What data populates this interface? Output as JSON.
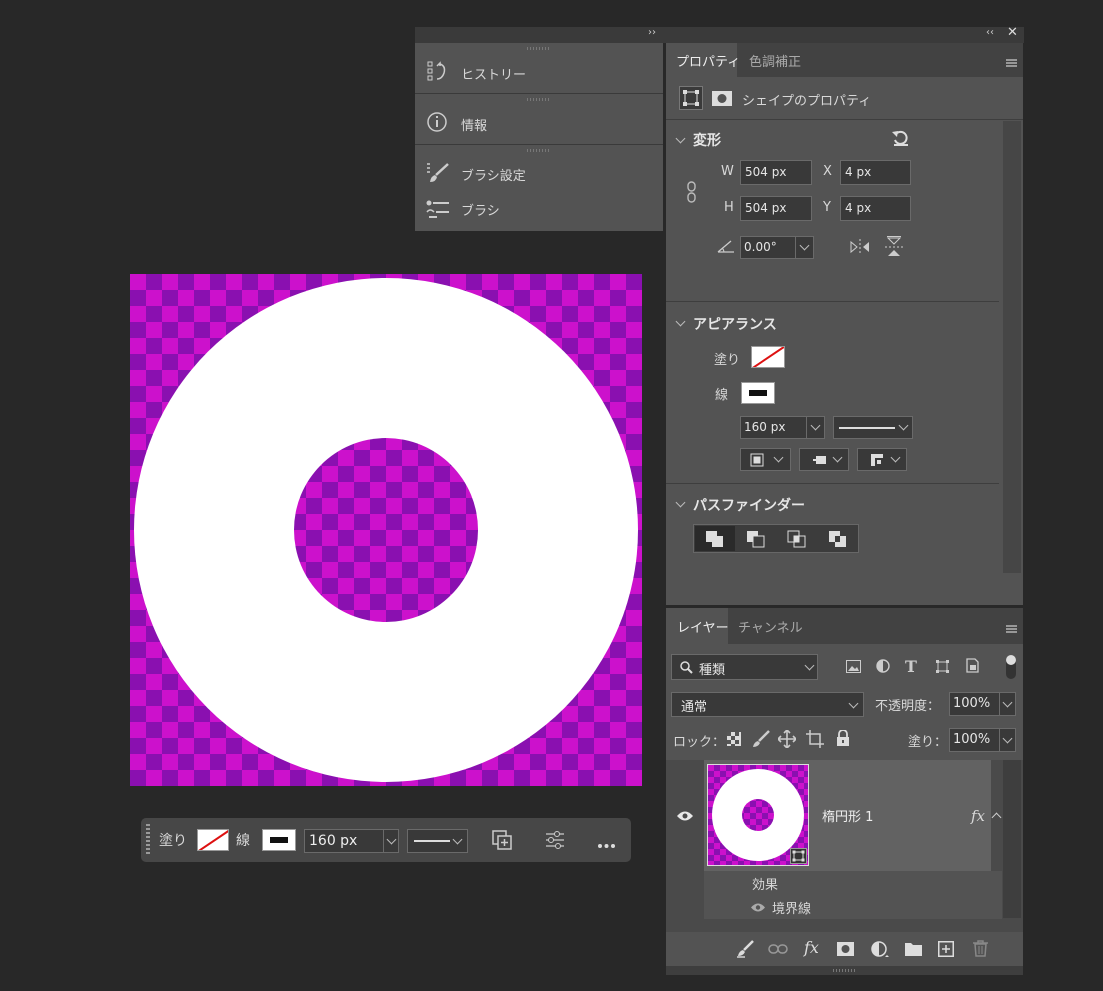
{
  "top_panel": {
    "items": [
      {
        "label": "ヒストリー",
        "icon": "history-icon"
      },
      {
        "label": "情報",
        "icon": "info-icon"
      },
      {
        "label": "ブラシ設定",
        "icon": "brush-settings-icon"
      },
      {
        "label": "ブラシ",
        "icon": "brushes-icon"
      }
    ]
  },
  "properties": {
    "tabs": [
      "プロパティ",
      "色調補正"
    ],
    "shape_title": "シェイプのプロパティ",
    "transform": {
      "header": "変形",
      "w_label": "W",
      "w_value": "504 px",
      "x_label": "X",
      "x_value": "4 px",
      "h_label": "H",
      "h_value": "504 px",
      "y_label": "Y",
      "y_value": "4 px",
      "angle": "0.00°"
    },
    "appearance": {
      "header": "アピアランス",
      "fill_label": "塗り",
      "stroke_label": "線",
      "stroke_width": "160 px"
    },
    "pathfinder": {
      "header": "パスファインダー"
    }
  },
  "layers": {
    "tabs": [
      "レイヤー",
      "チャンネル"
    ],
    "filter_kind": "種類",
    "blend_mode": "通常",
    "opacity_label": "不透明度：",
    "opacity_value": "100%",
    "lock_label": "ロック：",
    "fill_label": "塗り：",
    "fill_value": "100%",
    "layer_name": "楕円形 1",
    "fx_label": "fx",
    "effects_label": "効果",
    "effect_item": "境界線"
  },
  "context_bar": {
    "fill_label": "塗り",
    "stroke_label": "線",
    "stroke_width": "160 px"
  },
  "colors": {
    "panel": "#535353",
    "checker_a": "#cc11cc",
    "checker_b": "#8a10b0",
    "shape": "#ffffff"
  }
}
